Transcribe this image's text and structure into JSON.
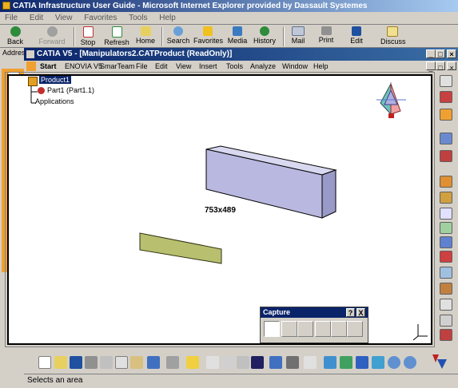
{
  "ie": {
    "title": "CATIA Infrastructure User Guide - Microsoft Internet Explorer provided by Dassault Systemes",
    "menu": [
      "File",
      "Edit",
      "View",
      "Favorites",
      "Tools",
      "Help"
    ],
    "toolbar": {
      "back": "Back",
      "forward": "Forward",
      "stop": "Stop",
      "refresh": "Refresh",
      "home": "Home",
      "search": "Search",
      "favorites": "Favorites",
      "media": "Media",
      "history": "History",
      "mail": "Mail",
      "print": "Print",
      "edit": "Edit",
      "discuss": "Discuss"
    },
    "address_label": "Address"
  },
  "catia": {
    "window_title": "CATIA V5 - [Manipulators2.CATProduct (ReadOnly)]",
    "menu": [
      "Start",
      "ENOVIA V5",
      "SmarTeam",
      "File",
      "Edit",
      "View",
      "Insert",
      "Tools",
      "Analyze",
      "Window",
      "Help"
    ],
    "tree": {
      "root": "Product1",
      "child": "Part1 (Part1.1)",
      "applications": "Applications"
    },
    "viewport_label": "753x489",
    "capture_toolbar": {
      "title": "Capture",
      "help": "?",
      "close": "X"
    },
    "status": "Selects an area"
  },
  "colors": {
    "title_bar": "#0a246a",
    "orange_toolbar": "#f0a030",
    "box_face": "#b8b8e0",
    "plane_face": "#b8c070"
  }
}
